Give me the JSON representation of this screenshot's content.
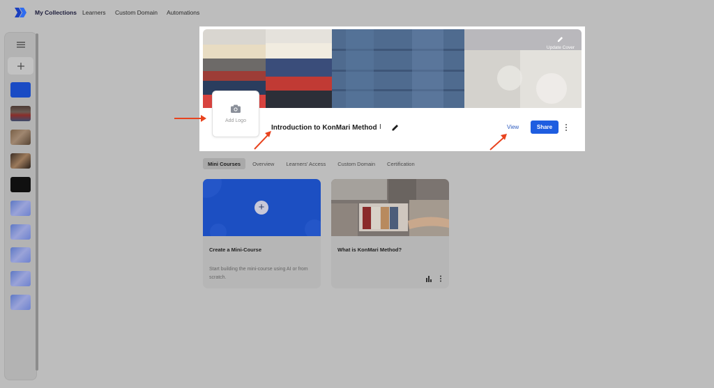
{
  "nav": {
    "items": [
      {
        "label": "My Collections",
        "active": true
      },
      {
        "label": "Learners",
        "active": false
      },
      {
        "label": "Custom Domain",
        "active": false
      },
      {
        "label": "Automations",
        "active": false
      }
    ]
  },
  "sidebar": {
    "menu_icon": "menu-icon",
    "add_icon": "plus-icon"
  },
  "header": {
    "update_cover": "Update Cover",
    "add_logo": "Add Logo",
    "title": "Introduction to KonMari Method",
    "view_label": "View",
    "share_label": "Share"
  },
  "tabs": [
    {
      "label": "Mini Courses",
      "active": true
    },
    {
      "label": "Overview",
      "active": false
    },
    {
      "label": "Learners' Access",
      "active": false
    },
    {
      "label": "Custom Domain",
      "active": false
    },
    {
      "label": "Certification",
      "active": false
    }
  ],
  "cards": {
    "create": {
      "title": "Create a Mini-Course",
      "description": "Start building the mini-course using AI or from scratch."
    },
    "existing": {
      "title": "What is KonMari Method?"
    }
  },
  "colors": {
    "accent": "#1e5de0",
    "arrow": "#e8431e",
    "overlay": "#bdbdbd"
  }
}
